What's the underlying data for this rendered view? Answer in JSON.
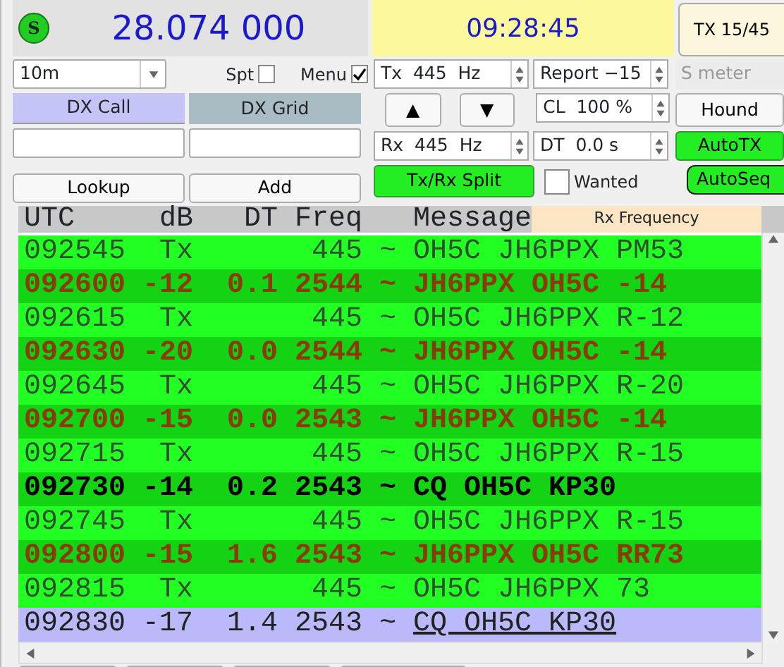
{
  "header": {
    "status_icon": "S",
    "frequency": "28.074 000",
    "clock": "09:28:45",
    "tx_period": "TX 15/45"
  },
  "controls": {
    "band": "10m",
    "checkboxes": [
      {
        "label": "Spt",
        "checked": false
      },
      {
        "label": "Menu",
        "checked": true
      }
    ],
    "tx_freq": "Tx  445  Hz",
    "report": "Report −15",
    "s_meter": {
      "label": "S meter",
      "disabled": true
    },
    "dx_call": "DX Call",
    "dx_grid": "DX Grid",
    "up": "▲",
    "down": "▼",
    "cl": "CL  100 %",
    "hound": "Hound",
    "rx_freq": "Rx  445  Hz",
    "dt": "DT  0.0 s",
    "toggles": [
      {
        "label": "AutoTX",
        "on": true
      },
      {
        "label": "AutoSeq",
        "on": true
      }
    ],
    "split": {
      "label": "Tx/Rx Split",
      "on": true
    },
    "wanted": {
      "label": "Wanted",
      "checked": false
    },
    "lookup": "Lookup",
    "add": "Add"
  },
  "decodes": {
    "columns": [
      "UTC",
      "dB",
      "DT",
      "Freq",
      "Message"
    ],
    "rx_frequency_label": "Rx Frequency",
    "rows": [
      {
        "kind": "tx",
        "utc": "092545",
        "db": "Tx",
        "dt": "",
        "freq": "445",
        "sep": "~",
        "message": "OH5C JH6PPX PM53"
      },
      {
        "kind": "rx",
        "utc": "092600",
        "db": "-12",
        "dt": "0.1",
        "freq": "2544",
        "sep": "~",
        "message": "JH6PPX OH5C -14"
      },
      {
        "kind": "tx",
        "utc": "092615",
        "db": "Tx",
        "dt": "",
        "freq": "445",
        "sep": "~",
        "message": "OH5C JH6PPX R-12"
      },
      {
        "kind": "rx",
        "utc": "092630",
        "db": "-20",
        "dt": "0.0",
        "freq": "2544",
        "sep": "~",
        "message": "JH6PPX OH5C -14"
      },
      {
        "kind": "tx",
        "utc": "092645",
        "db": "Tx",
        "dt": "",
        "freq": "445",
        "sep": "~",
        "message": "OH5C JH6PPX R-20"
      },
      {
        "kind": "rx",
        "utc": "092700",
        "db": "-15",
        "dt": "0.0",
        "freq": "2543",
        "sep": "~",
        "message": "JH6PPX OH5C -14"
      },
      {
        "kind": "tx",
        "utc": "092715",
        "db": "Tx",
        "dt": "",
        "freq": "445",
        "sep": "~",
        "message": "OH5C JH6PPX R-15"
      },
      {
        "kind": "cq",
        "utc": "092730",
        "db": "-14",
        "dt": "0.2",
        "freq": "2543",
        "sep": "~",
        "message": "CQ OH5C KP30"
      },
      {
        "kind": "tx",
        "utc": "092745",
        "db": "Tx",
        "dt": "",
        "freq": "445",
        "sep": "~",
        "message": "OH5C JH6PPX R-15"
      },
      {
        "kind": "rx",
        "utc": "092800",
        "db": "-15",
        "dt": "1.6",
        "freq": "2543",
        "sep": "~",
        "message": "JH6PPX OH5C RR73"
      },
      {
        "kind": "tx",
        "utc": "092815",
        "db": "Tx",
        "dt": "",
        "freq": "445",
        "sep": "~",
        "message": "OH5C JH6PPX 73"
      },
      {
        "kind": "current",
        "utc": "092830",
        "db": "-17",
        "dt": "1.4",
        "freq": "2543",
        "sep": "~",
        "message": "CQ OH5C KP30"
      }
    ]
  }
}
